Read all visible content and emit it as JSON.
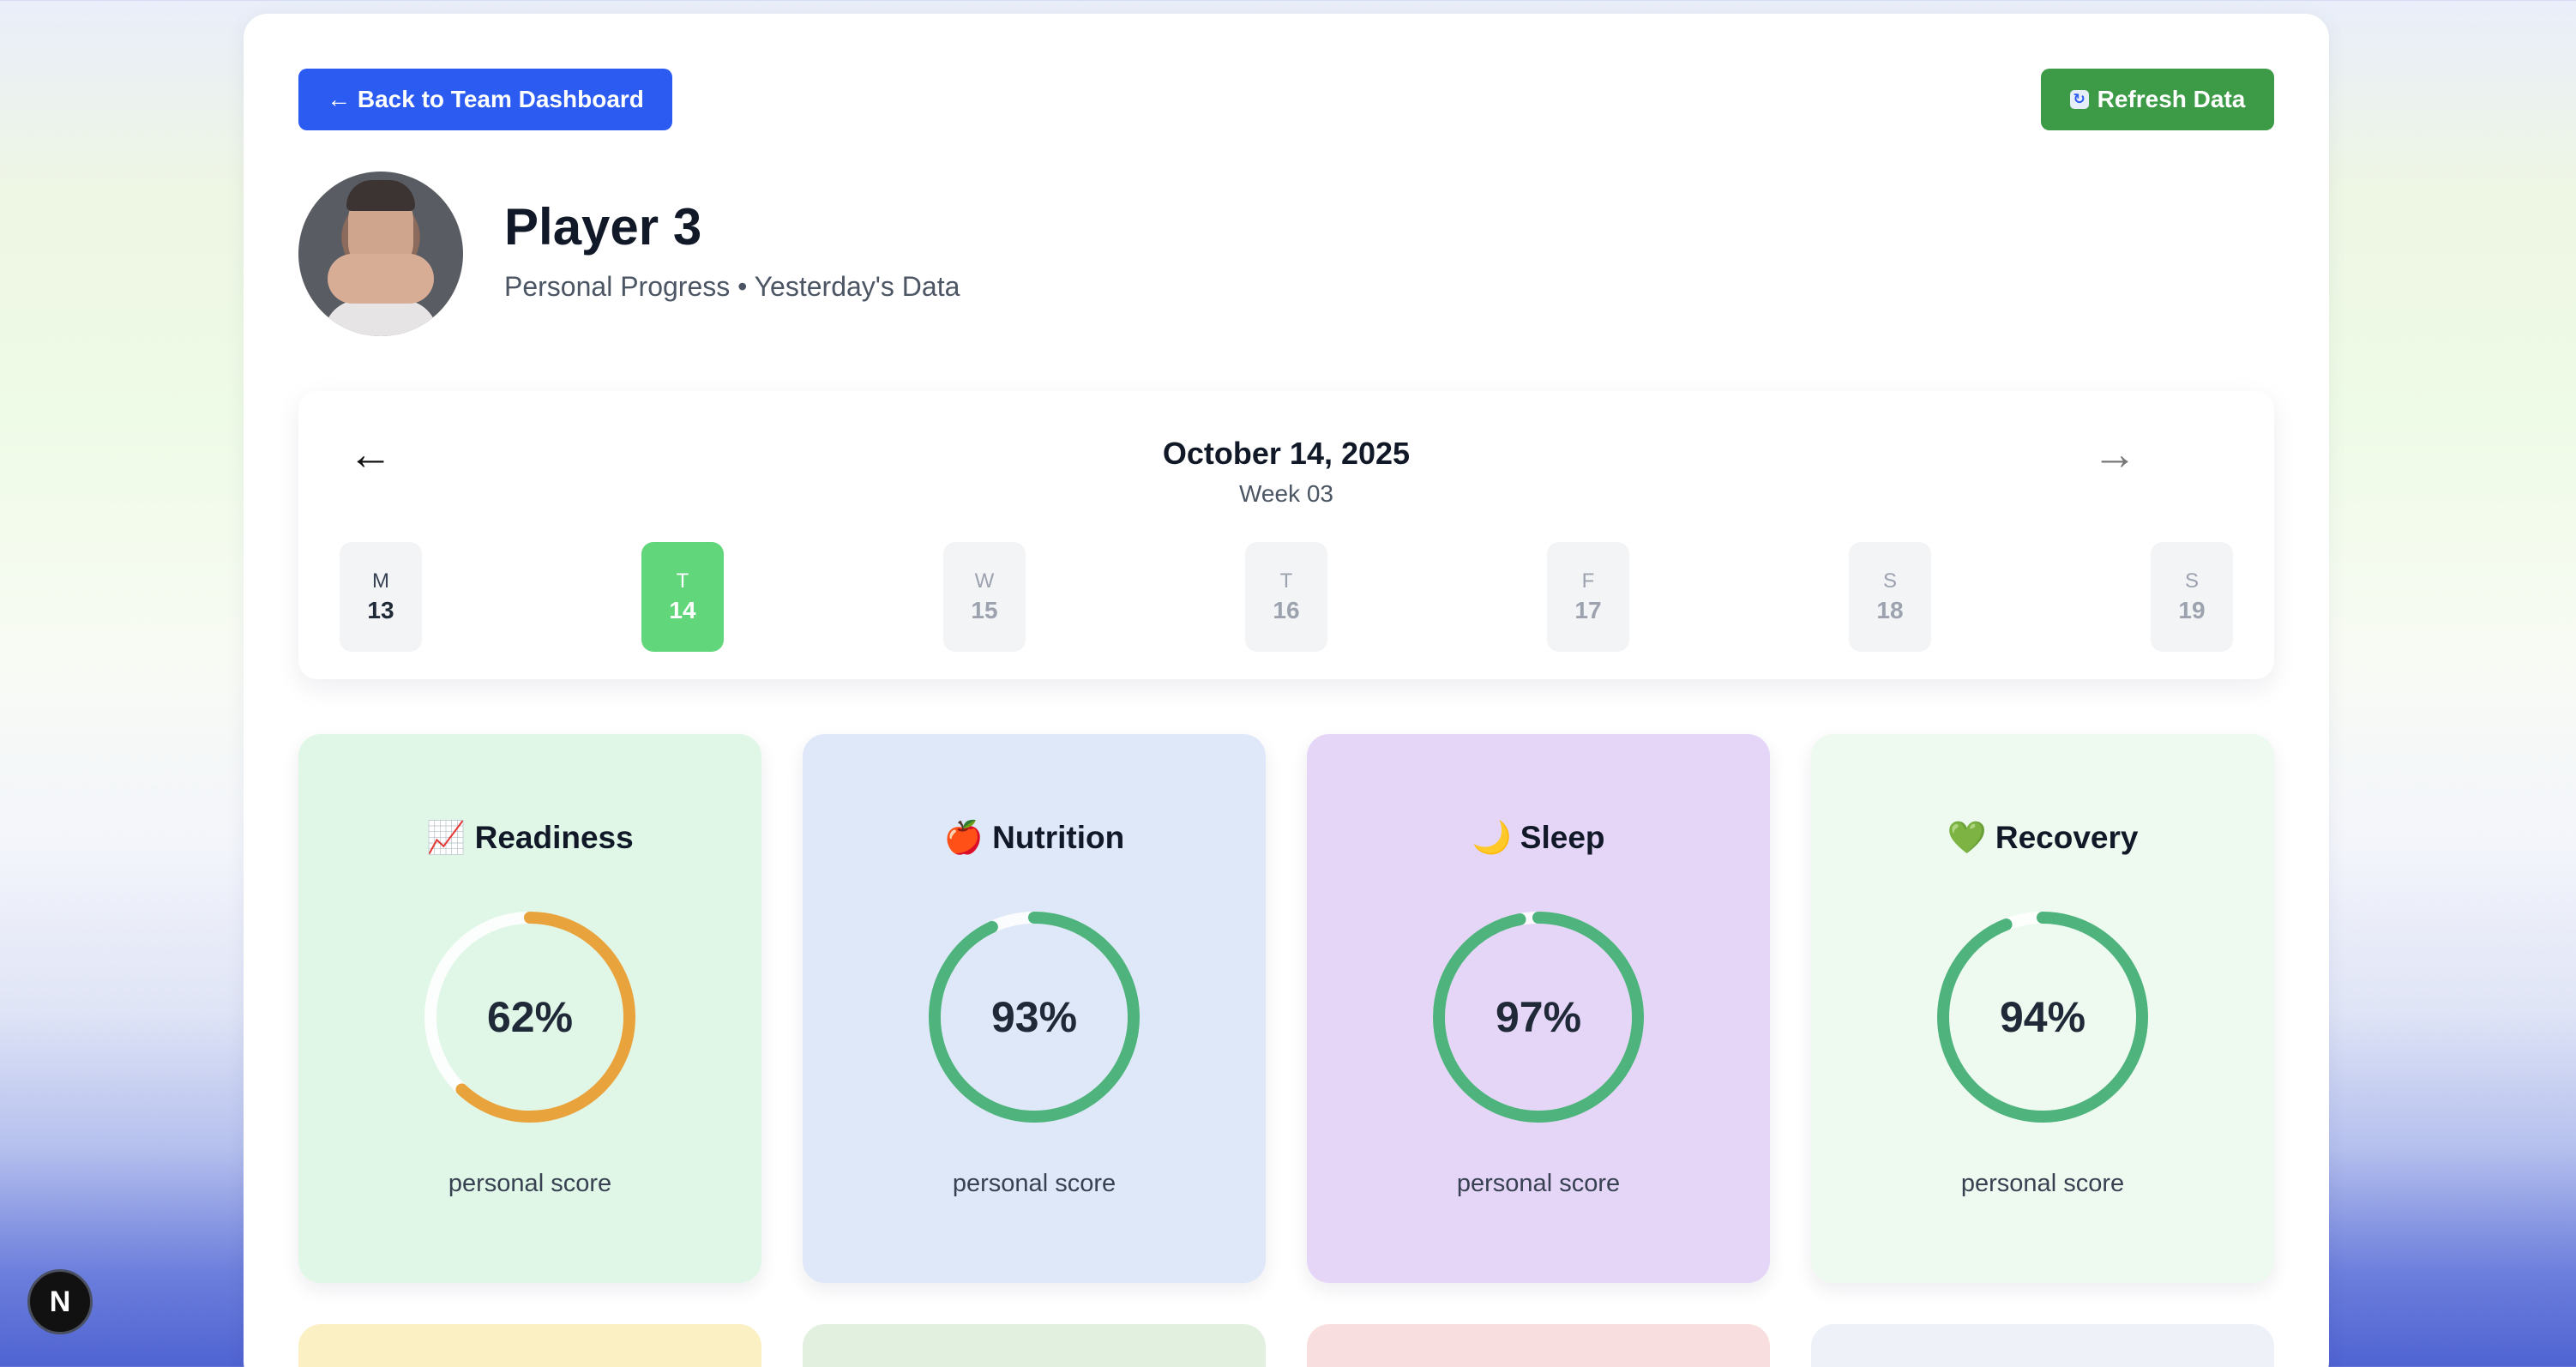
{
  "header": {
    "back_label": "← Back to Team Dashboard",
    "refresh_icon": "refresh-icon",
    "refresh_label": "Refresh Data"
  },
  "player": {
    "name": "Player 3",
    "subtitle": "Personal Progress • Yesterday's Data"
  },
  "calendar": {
    "prev_arrow": "←",
    "next_arrow": "→",
    "date": "October 14, 2025",
    "week": "Week 03",
    "days": [
      {
        "letter": "M",
        "num": "13",
        "state": "past"
      },
      {
        "letter": "T",
        "num": "14",
        "state": "active"
      },
      {
        "letter": "W",
        "num": "15",
        "state": "future"
      },
      {
        "letter": "T",
        "num": "16",
        "state": "future"
      },
      {
        "letter": "F",
        "num": "17",
        "state": "future"
      },
      {
        "letter": "S",
        "num": "18",
        "state": "future"
      },
      {
        "letter": "S",
        "num": "19",
        "state": "future"
      }
    ]
  },
  "metrics": [
    {
      "title": "📈 Readiness",
      "value": "62%",
      "percent": 62,
      "caption": "personal score",
      "bg": "#e0f7e7",
      "ring": "#e9a33d"
    },
    {
      "title": "🍎 Nutrition",
      "value": "93%",
      "percent": 93,
      "caption": "personal score",
      "bg": "#dfe8f8",
      "ring": "#4fb37d"
    },
    {
      "title": "🌙 Sleep",
      "value": "97%",
      "percent": 97,
      "caption": "personal score",
      "bg": "#e5d6f8",
      "ring": "#4fb37d"
    },
    {
      "title": "💚 Recovery",
      "value": "94%",
      "percent": 94,
      "caption": "personal score",
      "bg": "#eefaf0",
      "ring": "#4fb37d"
    }
  ],
  "peek_colors": [
    "#fbf0c4",
    "#e2f1df",
    "#f8dede",
    "#eef2f8"
  ],
  "badge": {
    "label": "N"
  }
}
